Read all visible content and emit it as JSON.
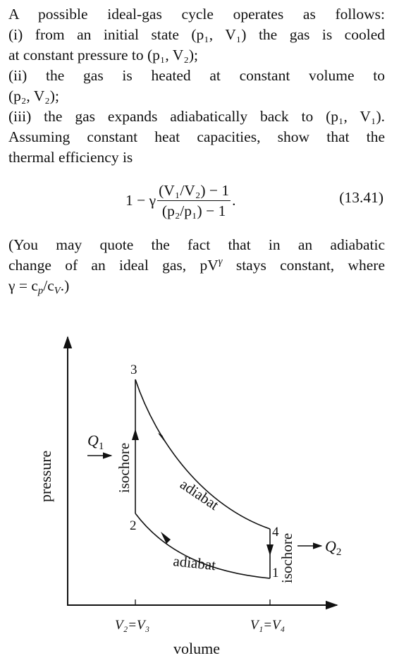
{
  "problem": {
    "lines": [
      "A possible ideal-gas cycle operates as follows:",
      "(i) from an initial state (p₁, V₁) the gas is cooled",
      "at constant pressure to (p₁, V₂);",
      "(ii) the gas is heated at constant volume to",
      "(p₂, V₂);",
      "(iii) the gas expands adiabatically back to (p₁, V₁).",
      "Assuming constant heat capacities, show that the",
      "thermal efficiency is"
    ],
    "equation": {
      "prefix": "1 − γ",
      "numerator": "(V₁/V₂) − 1",
      "denominator": "(p₂/p₁) − 1",
      "suffix": ".",
      "number": "(13.41)"
    },
    "note_lines": [
      "(You may quote the fact that in an adiabatic",
      "change of an ideal gas, pV",
      "stays constant, where",
      "γ = c",
      "/c",
      ".)"
    ],
    "note_superscript": "γ",
    "note_sub_p": "p",
    "note_sub_v": "V"
  },
  "diagram": {
    "y_axis_label": "pressure",
    "x_axis_label": "volume",
    "tick_labels": [
      "V₂=V₃",
      "V₁=V₄"
    ],
    "points": [
      "1",
      "2",
      "3",
      "4"
    ],
    "segment_labels": {
      "left_isochore": "isochore",
      "right_isochore": "isochore",
      "upper_adiabat": "adiabat",
      "lower_adiabat": "adiabat"
    },
    "heat_in": "Q",
    "heat_in_sub": "1",
    "heat_out": "Q",
    "heat_out_sub": "2"
  }
}
